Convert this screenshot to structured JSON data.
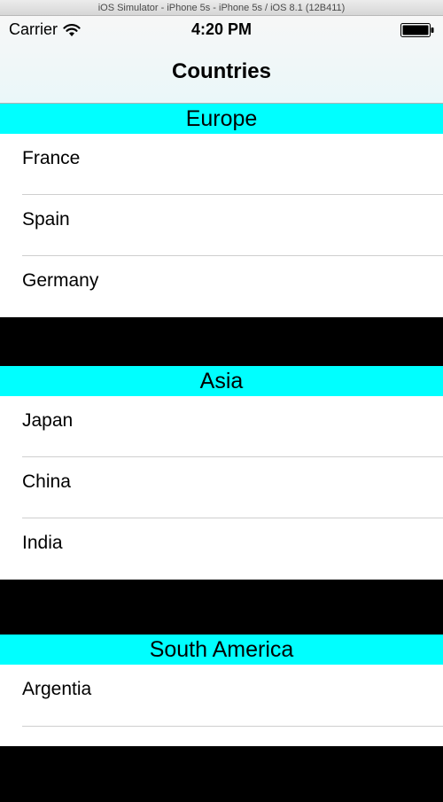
{
  "simulator": {
    "title": "iOS Simulator - iPhone 5s - iPhone 5s / iOS 8.1 (12B411)"
  },
  "status_bar": {
    "carrier": "Carrier",
    "time": "4:20 PM",
    "wifi_icon": "wifi-icon",
    "battery_icon": "battery-icon"
  },
  "nav": {
    "title": "Countries"
  },
  "sections": [
    {
      "header": "Europe",
      "rows": [
        "France",
        "Spain",
        "Germany"
      ]
    },
    {
      "header": "Asia",
      "rows": [
        "Japan",
        "China",
        "India"
      ]
    },
    {
      "header": "South America",
      "rows": [
        "Argentia"
      ]
    }
  ],
  "colors": {
    "section_header_bg": "#00ffff",
    "background": "#000000",
    "cell_bg": "#ffffff"
  }
}
